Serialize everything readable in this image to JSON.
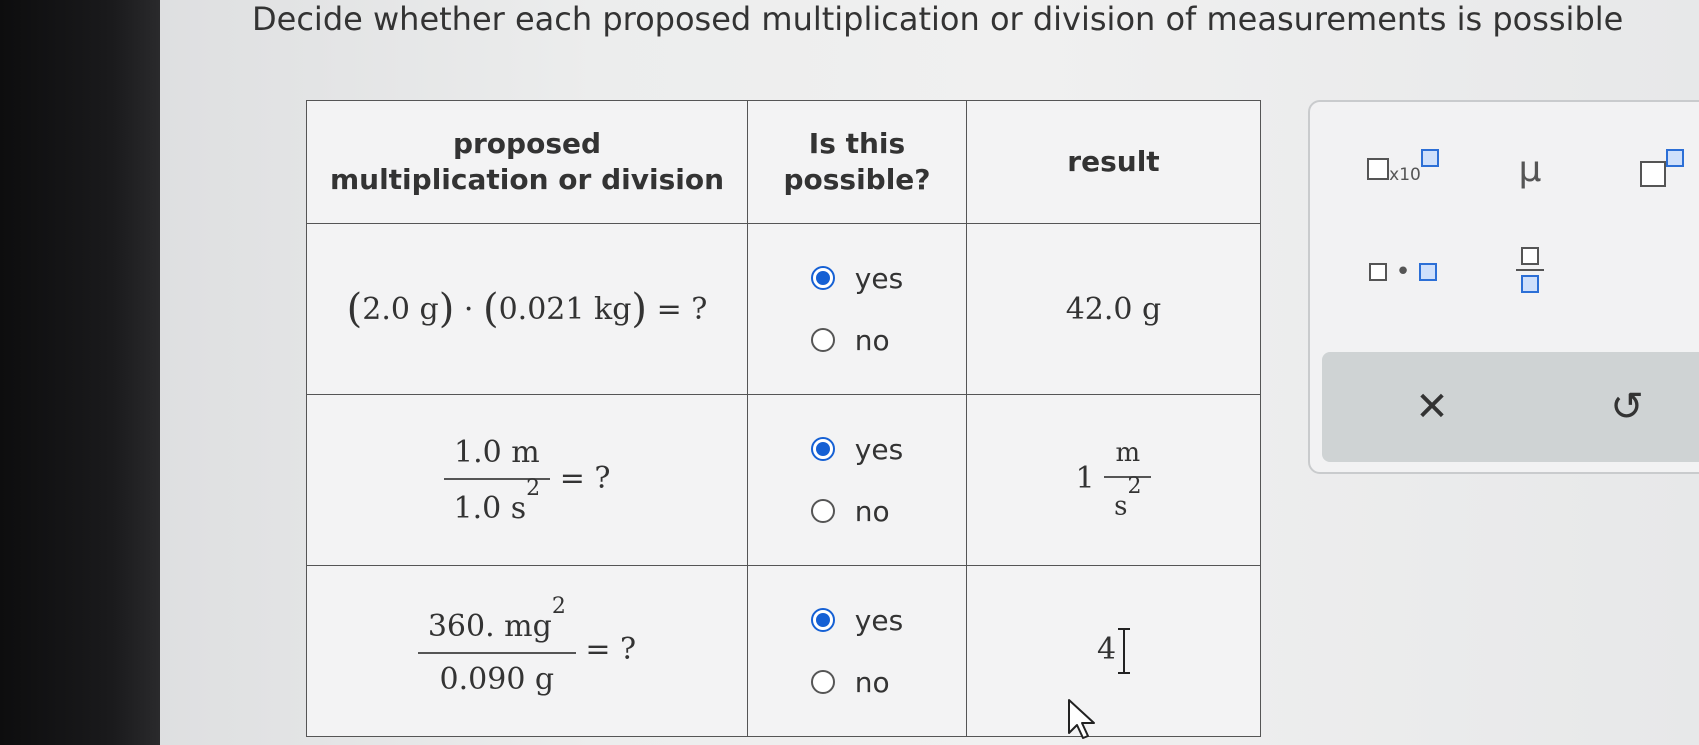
{
  "instruction": "Decide whether each proposed multiplication or division of measurements is possible",
  "table": {
    "headers": {
      "col1_line1": "proposed",
      "col1_line2": "multiplication or division",
      "col2_line1": "Is this",
      "col2_line2": "possible?",
      "col3": "result"
    },
    "rows": [
      {
        "expr": {
          "open1": "(",
          "a": "2.0 g",
          "close1": ")",
          "dot": "·",
          "open2": "(",
          "b": "0.021 kg",
          "close2": ")",
          "tail": "= ?"
        },
        "yes_label": "yes",
        "no_label": "no",
        "selected": "yes",
        "result": "42.0 g"
      },
      {
        "expr": {
          "num": "1.0 m",
          "den": "1.0 s",
          "den_exp": "2",
          "tail": "= ?"
        },
        "yes_label": "yes",
        "no_label": "no",
        "selected": "yes",
        "result": {
          "coef": "1",
          "num": "m",
          "den": "s",
          "den_exp": "2"
        }
      },
      {
        "expr": {
          "num": "360. mg",
          "num_exp": "2",
          "den": "0.090 g",
          "tail": "= ?"
        },
        "yes_label": "yes",
        "no_label": "no",
        "selected": "yes",
        "result": "4"
      }
    ]
  },
  "keypad": {
    "x10_label": "x10",
    "mu_label": "μ",
    "clear_symbol": "✕",
    "undo_symbol": "↺",
    "dot_symbol": "•"
  },
  "colors": {
    "radio_selected": "#1560d4",
    "key_box_blue": "#2c6fd6",
    "action_bar": "#cfd3d4"
  }
}
